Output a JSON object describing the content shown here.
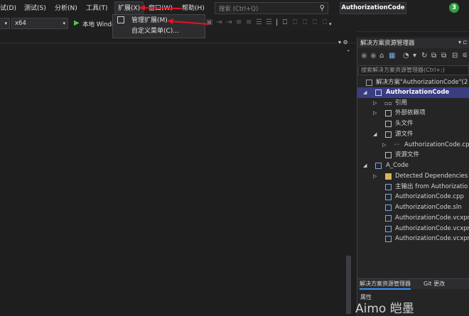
{
  "menubar": {
    "items": [
      "试(D)",
      "测试(S)",
      "分析(N)",
      "工具(T)",
      "扩展(X)",
      "窗口(W)",
      "帮助(H)"
    ]
  },
  "search": {
    "placeholder": "搜索 (Ctrl+Q)"
  },
  "solution_title": "AuthorizationCode",
  "notifications": "3",
  "toolbar": {
    "platform": "x64",
    "run_label": "本地 Windo"
  },
  "extensions_menu": {
    "items": [
      "管理扩展(M)",
      "自定义菜单(C)..."
    ]
  },
  "solution_explorer": {
    "title": "解决方案资源管理器",
    "search_placeholder": "搜索解决方案资源管理器(Ctrl+;)",
    "rows": [
      "解决方案\"AuthorizationCode\"(2",
      "AuthorizationCode",
      "引用",
      "外部依赖项",
      "头文件",
      "源文件",
      "AuthorizationCode.cpp",
      "资源文件",
      "A_Code",
      "Detected Dependencies",
      "主输出 from Authorizatio",
      "AuthorizationCode.cpp",
      "AuthorizationCode.sln",
      "AuthorizationCode.vcxpr",
      "AuthorizationCode.vcxpr",
      "AuthorizationCode.vcxpr"
    ],
    "tabs": [
      "解决方案资源管理器",
      "Git 更改"
    ],
    "properties_label": "属性"
  },
  "watermark": "Aimo 皑墨",
  "colors": {
    "accent": "#3a3d80",
    "arrow": "#e81123",
    "badge": "#2ea043"
  }
}
